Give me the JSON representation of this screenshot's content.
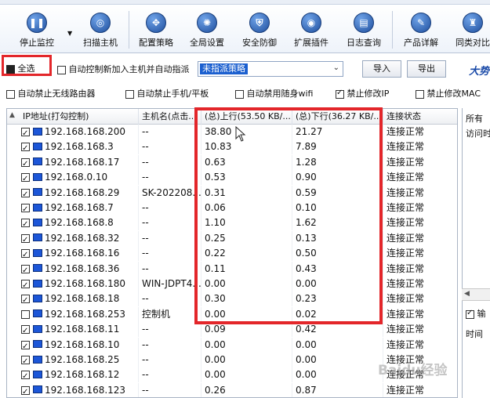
{
  "toolbar": {
    "buttons": [
      {
        "label": "停止监控",
        "icon": "pause-icon"
      },
      {
        "label": "扫描主机",
        "icon": "search-icon"
      },
      {
        "label": "配置策略",
        "icon": "settings-icon"
      },
      {
        "label": "全局设置",
        "icon": "gear-icon"
      },
      {
        "label": "安全防御",
        "icon": "shield-icon"
      },
      {
        "label": "扩展插件",
        "icon": "wifi-icon"
      },
      {
        "label": "日志查询",
        "icon": "log-icon"
      },
      {
        "label": "产品详解",
        "icon": "edit-icon"
      },
      {
        "label": "同类对比",
        "icon": "graduation-icon"
      }
    ]
  },
  "controls": {
    "select_all_label": "全选",
    "auto_control_label": "自动控制新加入主机并自动指派",
    "policy_value": "未指派策略",
    "import_label": "导入",
    "export_label": "导出",
    "brand_text": "大势"
  },
  "options": [
    {
      "label": "自动禁止无线路由器",
      "checked": false
    },
    {
      "label": "自动禁止手机/平板",
      "checked": false
    },
    {
      "label": "自动禁用随身wifi",
      "checked": false
    },
    {
      "label": "禁止修改IP",
      "checked": true
    },
    {
      "label": "禁止修改MAC",
      "checked": false
    }
  ],
  "table": {
    "headers": [
      "IP地址(打勾控制)",
      "主机名(点击...",
      "(总)上行(53.50 KB/...",
      "(总)下行(36.27 KB/...",
      "连接状态"
    ],
    "rows": [
      {
        "checked": true,
        "ip": "192.168.168.200",
        "host": "--",
        "up": "38.80",
        "down": "21.27",
        "status": "连接正常"
      },
      {
        "checked": true,
        "ip": "192.168.168.3",
        "host": "--",
        "up": "10.83",
        "down": "7.89",
        "status": "连接正常"
      },
      {
        "checked": true,
        "ip": "192.168.168.17",
        "host": "--",
        "up": "0.63",
        "down": "1.28",
        "status": "连接正常"
      },
      {
        "checked": true,
        "ip": "192.168.0.10",
        "host": "--",
        "up": "0.53",
        "down": "0.90",
        "status": "连接正常"
      },
      {
        "checked": true,
        "ip": "192.168.168.29",
        "host": "SK-202208...",
        "up": "0.31",
        "down": "0.59",
        "status": "连接正常"
      },
      {
        "checked": true,
        "ip": "192.168.168.7",
        "host": "--",
        "up": "0.06",
        "down": "0.10",
        "status": "连接正常"
      },
      {
        "checked": true,
        "ip": "192.168.168.8",
        "host": "--",
        "up": "1.10",
        "down": "1.62",
        "status": "连接正常"
      },
      {
        "checked": true,
        "ip": "192.168.168.32",
        "host": "--",
        "up": "0.25",
        "down": "0.13",
        "status": "连接正常"
      },
      {
        "checked": true,
        "ip": "192.168.168.16",
        "host": "--",
        "up": "0.22",
        "down": "0.50",
        "status": "连接正常"
      },
      {
        "checked": true,
        "ip": "192.168.168.36",
        "host": "--",
        "up": "0.11",
        "down": "0.43",
        "status": "连接正常"
      },
      {
        "checked": true,
        "ip": "192.168.168.180",
        "host": "WIN-JDPT4...",
        "up": "0.00",
        "down": "0.00",
        "status": "连接正常"
      },
      {
        "checked": true,
        "ip": "192.168.168.18",
        "host": "--",
        "up": "0.30",
        "down": "0.23",
        "status": "连接正常"
      },
      {
        "checked": false,
        "ip": "192.168.168.253",
        "host": "控制机",
        "up": "0.00",
        "down": "0.02",
        "status": "连接正常"
      },
      {
        "checked": true,
        "ip": "192.168.168.11",
        "host": "--",
        "up": "0.09",
        "down": "0.42",
        "status": "连接正常"
      },
      {
        "checked": true,
        "ip": "192.168.168.10",
        "host": "--",
        "up": "0.00",
        "down": "0.00",
        "status": "连接正常"
      },
      {
        "checked": true,
        "ip": "192.168.168.25",
        "host": "--",
        "up": "0.00",
        "down": "0.00",
        "status": "连接正常"
      },
      {
        "checked": true,
        "ip": "192.168.168.12",
        "host": "--",
        "up": "0.00",
        "down": "0.00",
        "status": "连接正常"
      },
      {
        "checked": true,
        "ip": "192.168.168.123",
        "host": "--",
        "up": "0.26",
        "down": "0.87",
        "status": "连接正常"
      }
    ]
  },
  "side_panel": {
    "header": "所有",
    "line1": "访问时",
    "check_label": "输",
    "footer": "时间"
  },
  "watermark": "Baidu经验",
  "colors": {
    "highlight_red": "#e3262a",
    "selection_blue": "#1b5fcf",
    "brand_blue": "#1a4aa8"
  }
}
